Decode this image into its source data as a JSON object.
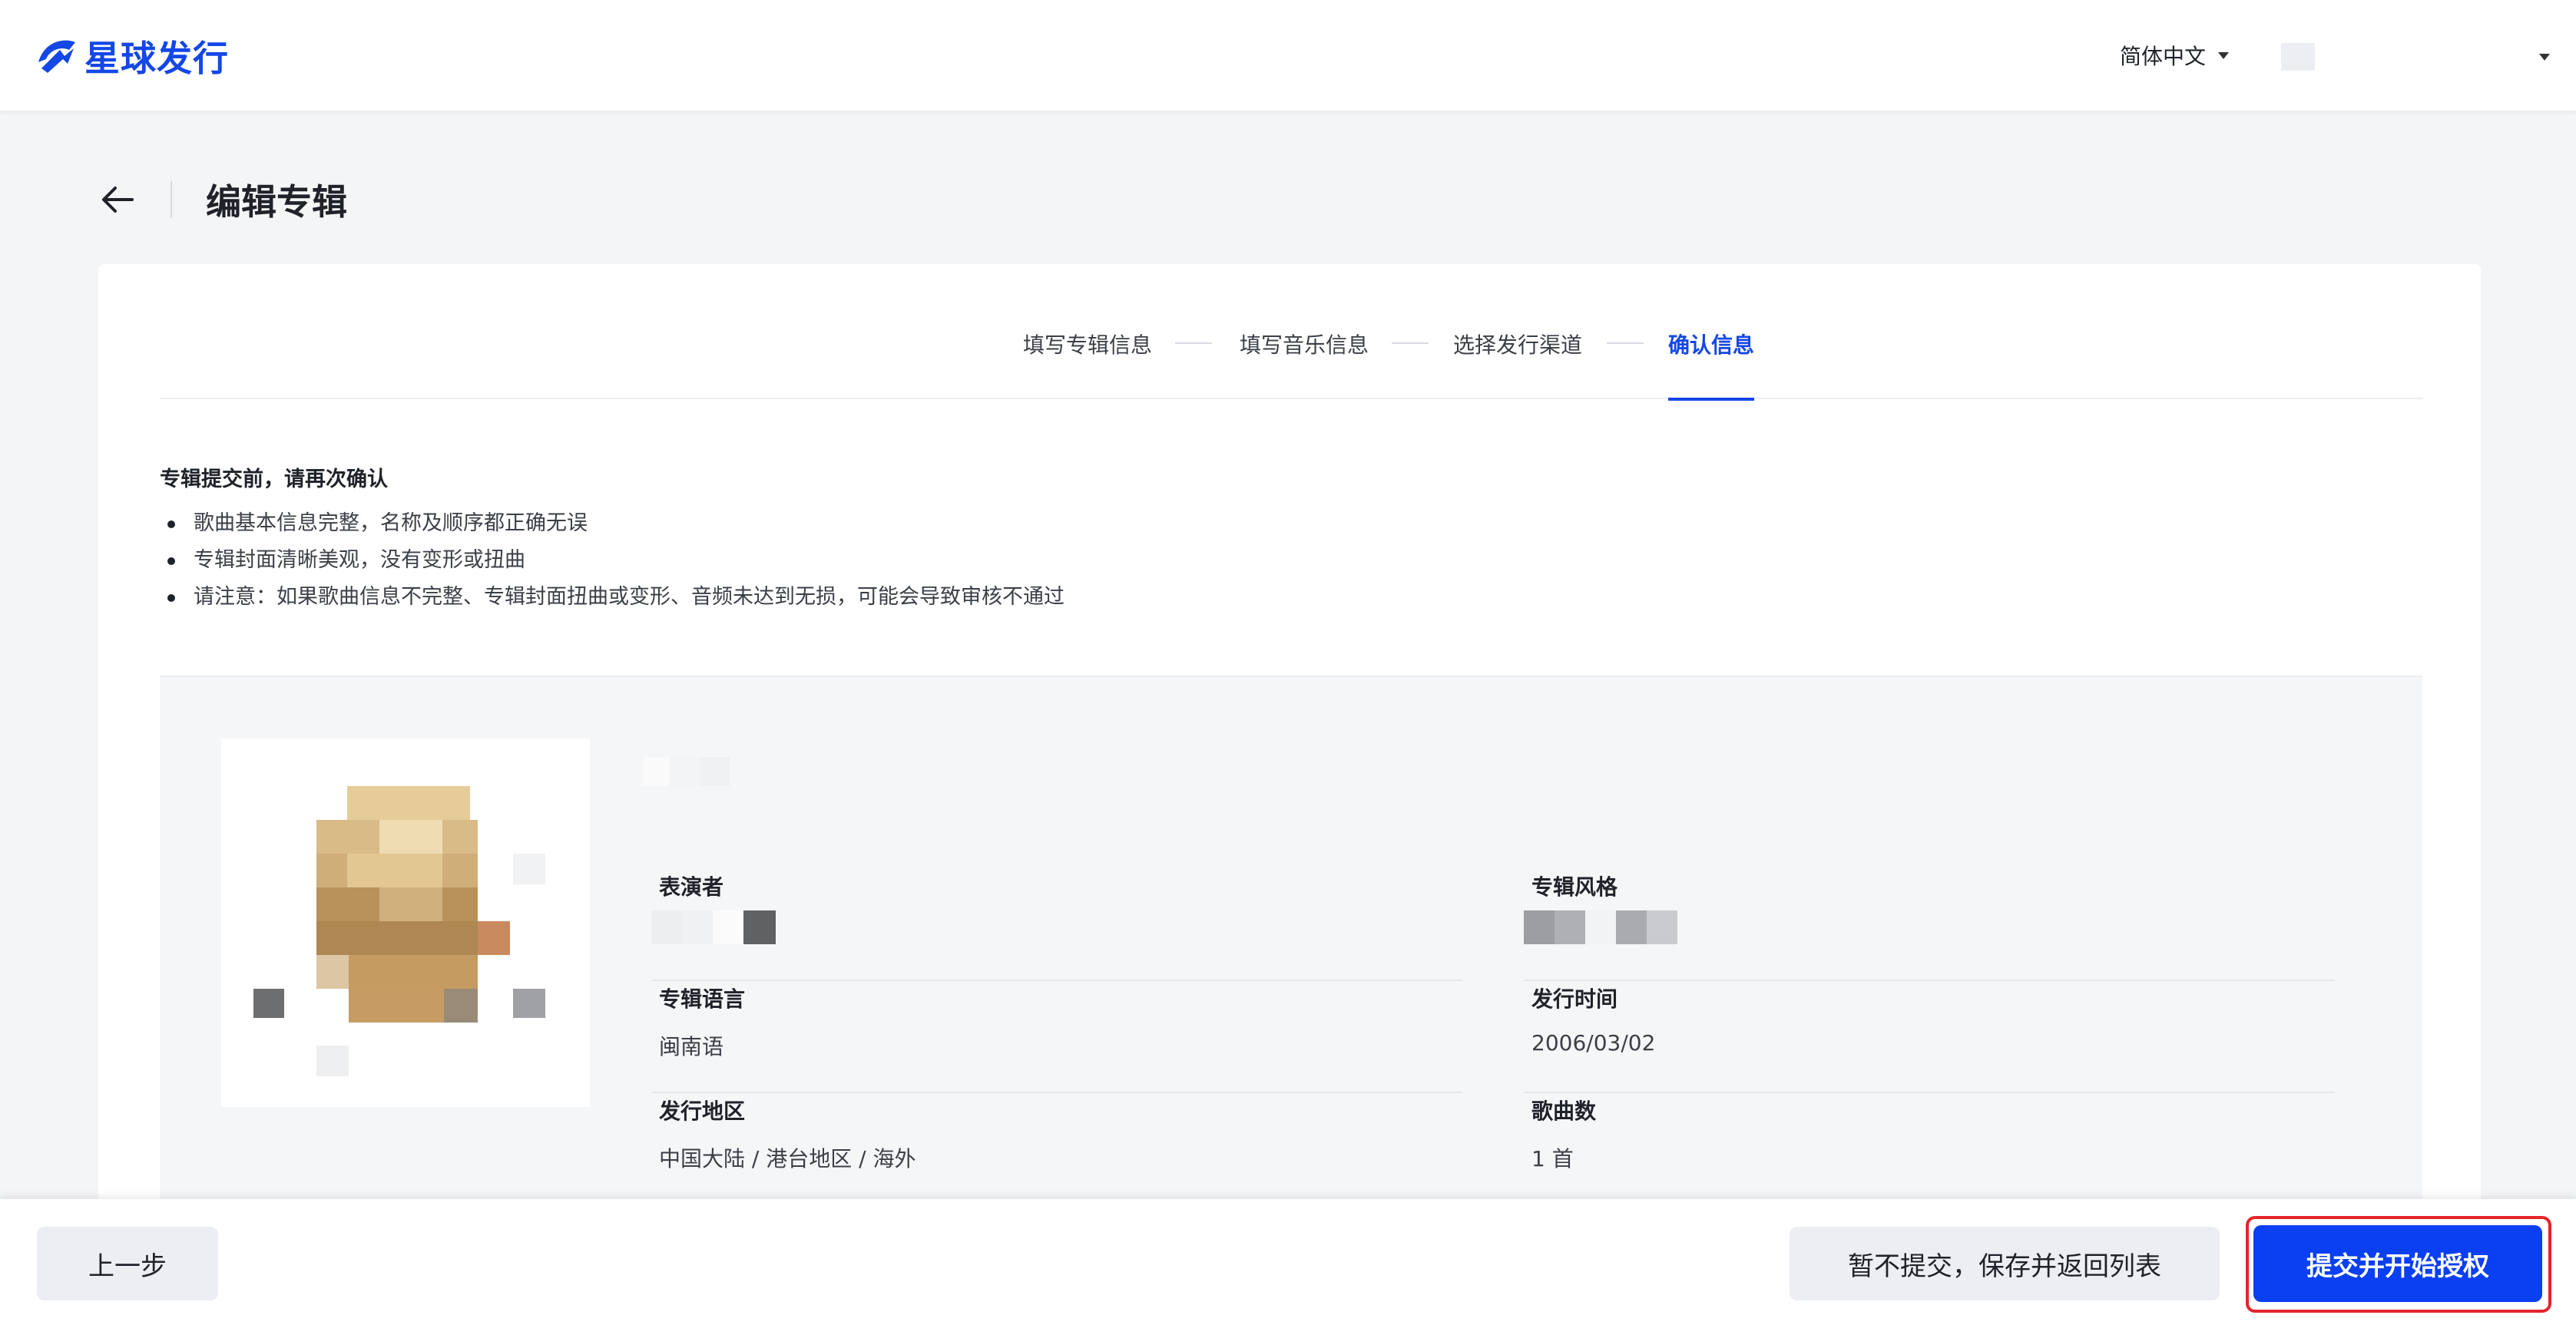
{
  "header": {
    "brand": "星球发行",
    "language": "简体中文"
  },
  "page": {
    "title": "编辑专辑"
  },
  "steps": [
    {
      "label": "填写专辑信息",
      "active": false
    },
    {
      "label": "填写音乐信息",
      "active": false
    },
    {
      "label": "选择发行渠道",
      "active": false
    },
    {
      "label": "确认信息",
      "active": true
    }
  ],
  "notice": {
    "title": "专辑提交前，请再次确认",
    "items": [
      "歌曲基本信息完整，名称及顺序都正确无误",
      "专辑封面清晰美观，没有变形或扭曲",
      "请注意：如果歌曲信息不完整、专辑封面扭曲或变形、音频未达到无损，可能会导致审核不通过"
    ]
  },
  "album": {
    "fields": {
      "performer": {
        "label": "表演者"
      },
      "style": {
        "label": "专辑风格"
      },
      "language": {
        "label": "专辑语言",
        "value": "闽南语"
      },
      "release_date": {
        "label": "发行时间",
        "value": "2006/03/02"
      },
      "region": {
        "label": "发行地区",
        "value": "中国大陆 / 港台地区 / 海外"
      },
      "track_count": {
        "label": "歌曲数",
        "value": "1 首"
      }
    }
  },
  "actions": {
    "prev": "上一步",
    "save": "暂不提交，保存并返回列表",
    "submit": "提交并开始授权"
  },
  "colors": {
    "brand": "#1447e6",
    "submit_button": "#0a3ff2",
    "highlight_frame": "#e5242b",
    "page_background": "#f4f5f7"
  }
}
